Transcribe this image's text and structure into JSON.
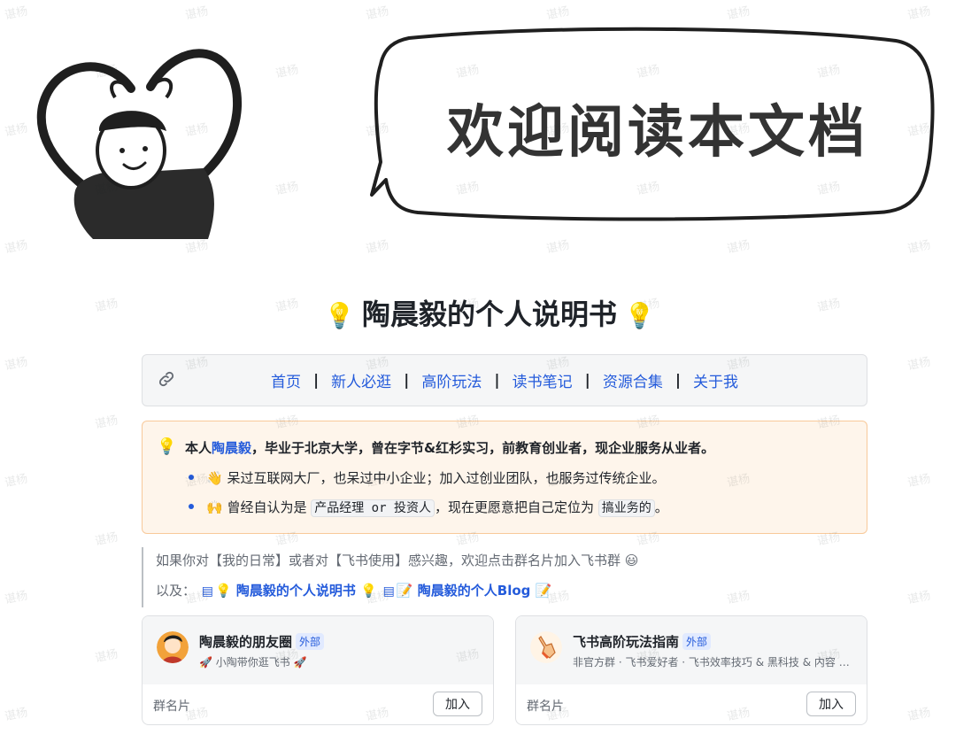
{
  "watermark": "谌杨",
  "banner": {
    "speech_text": "欢迎阅读本文档"
  },
  "title": {
    "text": "陶晨毅的个人说明书",
    "bulb": "💡"
  },
  "nav": {
    "icon": "link-icon",
    "links": [
      "首页",
      "新人必逛",
      "高阶玩法",
      "读书笔记",
      "资源合集",
      "关于我"
    ],
    "separator": "|"
  },
  "intro": {
    "bulb": "💡",
    "prefix": "本人",
    "name": "陶晨毅",
    "suffix": "，毕业于北京大学，曾在字节&红杉实习，前教育创业者，现企业服务从业者。",
    "bullet1": "👋 呆过互联网大厂，也呆过中小企业；加入过创业团队，也服务过传统企业。",
    "bullet2_pre": "🙌 曾经自认为是",
    "bullet2_code1": "产品经理 or 投资人",
    "bullet2_mid": "，现在更愿意把自己定位为",
    "bullet2_code2": "搞业务的",
    "bullet2_post": "。"
  },
  "quote": {
    "line1": "如果你对【我的日常】或者对【飞书使用】感兴趣，欢迎点击群名片加入飞书群 😃",
    "line2_prefix": "以及：",
    "doc1": "💡 陶晨毅的个人说明书 💡",
    "doc2": "📝 陶晨毅的个人Blog 📝"
  },
  "cards": [
    {
      "name": "陶晨毅的朋友圈",
      "tag": "外部",
      "desc": "🚀 小陶带你逛飞书 🚀",
      "footer": "群名片",
      "button": "加入"
    },
    {
      "name": "飞书高阶玩法指南",
      "tag": "外部",
      "desc": "非官方群 · 飞书爱好者 · 飞书效率技巧 & 黑科技 & 内容 · ...",
      "footer": "群名片",
      "button": "加入"
    }
  ],
  "colors": {
    "link": "#245bdb",
    "callout_bg": "#fef5eb",
    "callout_border": "#f8c99a",
    "nav_bg": "#f5f6f7"
  }
}
